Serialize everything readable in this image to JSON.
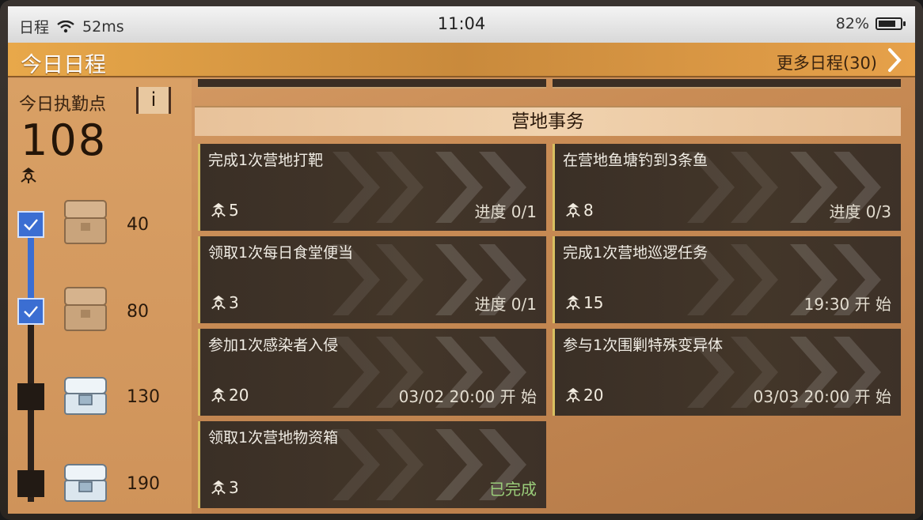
{
  "statusbar": {
    "app": "日程",
    "ping": "52ms",
    "time": "11:04",
    "battery": "82%",
    "battery_level": 0.82
  },
  "titlebar": {
    "title": "今日日程",
    "more": "更多日程(30)"
  },
  "left": {
    "duty_label": "今日执勤点",
    "info_label": "i",
    "duty_value": "108",
    "progress_fraction": 0.35,
    "rewards": [
      {
        "threshold": "40",
        "claimed": true,
        "chest": "brown-chest-icon"
      },
      {
        "threshold": "80",
        "claimed": true,
        "chest": "brown-chest-icon"
      },
      {
        "threshold": "130",
        "claimed": false,
        "chest": "silver-chest-icon"
      },
      {
        "threshold": "190",
        "claimed": false,
        "chest": "silver-chest-icon"
      }
    ]
  },
  "section": {
    "title": "营地事务"
  },
  "tasks": [
    {
      "name": "完成1次营地打靶",
      "points": "5",
      "status": "进度 0/1",
      "done": false
    },
    {
      "name": "在营地鱼塘钓到3条鱼",
      "points": "8",
      "status": "进度 0/3",
      "done": false
    },
    {
      "name": "领取1次每日食堂便当",
      "points": "3",
      "status": "进度 0/1",
      "done": false
    },
    {
      "name": "完成1次营地巡逻任务",
      "points": "15",
      "status": "19:30 开 始",
      "done": false
    },
    {
      "name": "参加1次感染者入侵",
      "points": "20",
      "status": "03/02 20:00 开 始",
      "done": false
    },
    {
      "name": "参与1次围剿特殊变异体",
      "points": "20",
      "status": "03/03 20:00 开 始",
      "done": false
    },
    {
      "name": "领取1次营地物资箱",
      "points": "3",
      "status": "已完成",
      "done": true
    }
  ],
  "colors": {
    "accent_blue": "#3b6ed2",
    "task_bar": "#d8c060",
    "done_green": "#9acd7a"
  }
}
